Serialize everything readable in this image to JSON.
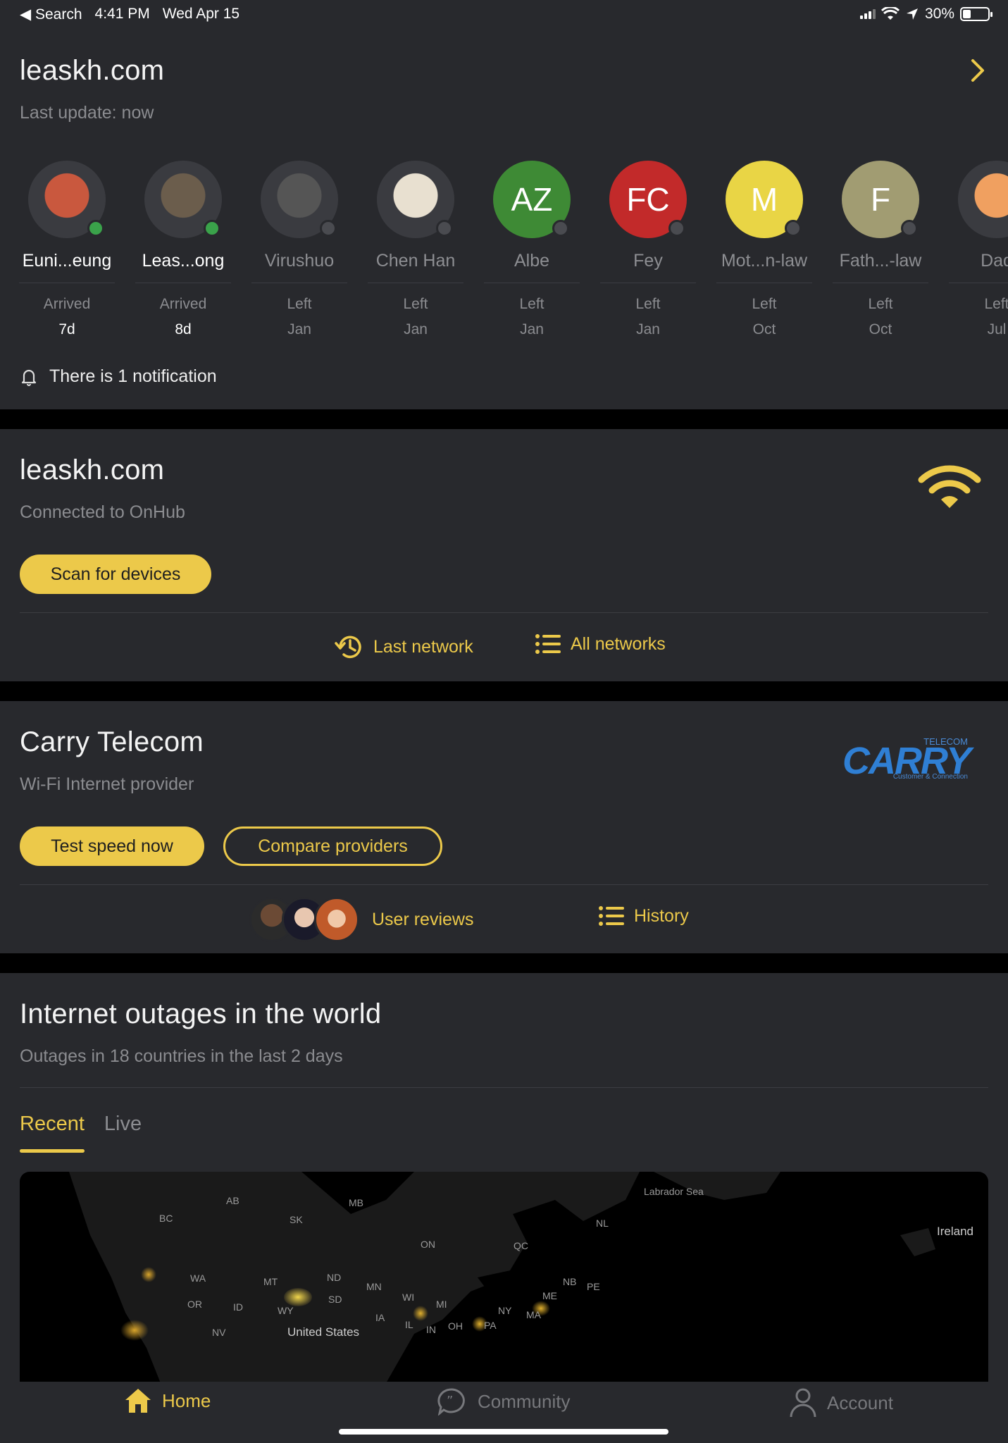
{
  "status_bar": {
    "back_label": "◀ Search",
    "time": "4:41 PM",
    "date": "Wed Apr 15",
    "battery": "30%"
  },
  "home_card": {
    "title": "leaskh.com",
    "subtitle": "Last update: now",
    "people": [
      {
        "name": "Euni...eung",
        "status": "Arrived",
        "time": "7d",
        "online": true,
        "avatar": "photo",
        "color": "#c9583e"
      },
      {
        "name": "Leas...ong",
        "status": "Arrived",
        "time": "8d",
        "online": true,
        "avatar": "photo",
        "color": "#6b5d4c"
      },
      {
        "name": "Virushuo",
        "status": "Left",
        "time": "Jan",
        "online": false,
        "avatar": "photo",
        "color": "#555"
      },
      {
        "name": "Chen Han",
        "status": "Left",
        "time": "Jan",
        "online": false,
        "avatar": "photo",
        "color": "#e8e0d0"
      },
      {
        "name": "Albe",
        "status": "Left",
        "time": "Jan",
        "online": false,
        "avatar": "AZ",
        "color": "#3e8a35"
      },
      {
        "name": "Fey",
        "status": "Left",
        "time": "Jan",
        "online": false,
        "avatar": "FC",
        "color": "#c22a2a"
      },
      {
        "name": "Mot...n-law",
        "status": "Left",
        "time": "Oct",
        "online": false,
        "avatar": "M",
        "color": "#e9d545"
      },
      {
        "name": "Fath...-law",
        "status": "Left",
        "time": "Oct",
        "online": false,
        "avatar": "F",
        "color": "#a19c72"
      },
      {
        "name": "Dad",
        "status": "Left",
        "time": "Jul",
        "online": false,
        "avatar": "photo",
        "color": "#f0a060"
      }
    ],
    "notification": "There is 1 notification"
  },
  "network_card": {
    "title": "leaskh.com",
    "subtitle": "Connected to OnHub",
    "scan_button": "Scan for devices",
    "last_network": "Last network",
    "all_networks": "All networks"
  },
  "isp_card": {
    "title": "Carry Telecom",
    "subtitle": "Wi-Fi Internet provider",
    "logo_text": "CARRY",
    "logo_top": "TELECOM",
    "logo_tagline": "Customer & Connection",
    "test_button": "Test speed now",
    "compare_button": "Compare providers",
    "user_reviews": "User reviews",
    "history": "History"
  },
  "outages_card": {
    "title": "Internet outages in the world",
    "subtitle": "Outages in 18 countries in the last 2 days",
    "tabs": [
      "Recent",
      "Live"
    ],
    "map_labels": [
      "Labrador Sea",
      "Ireland",
      "AB",
      "BC",
      "SK",
      "MB",
      "ON",
      "QC",
      "NL",
      "WA",
      "MT",
      "ND",
      "MN",
      "SD",
      "WI",
      "MI",
      "NY",
      "ME",
      "NB",
      "PE",
      "OR",
      "ID",
      "WY",
      "IA",
      "IL",
      "IN",
      "OH",
      "PA",
      "MA",
      "NV",
      "United States"
    ]
  },
  "tab_bar": {
    "home": "Home",
    "community": "Community",
    "account": "Account"
  },
  "colors": {
    "accent": "#ecc94a",
    "card_bg": "#28292d",
    "online": "#3aa24a",
    "offline": "#4a4b50"
  }
}
